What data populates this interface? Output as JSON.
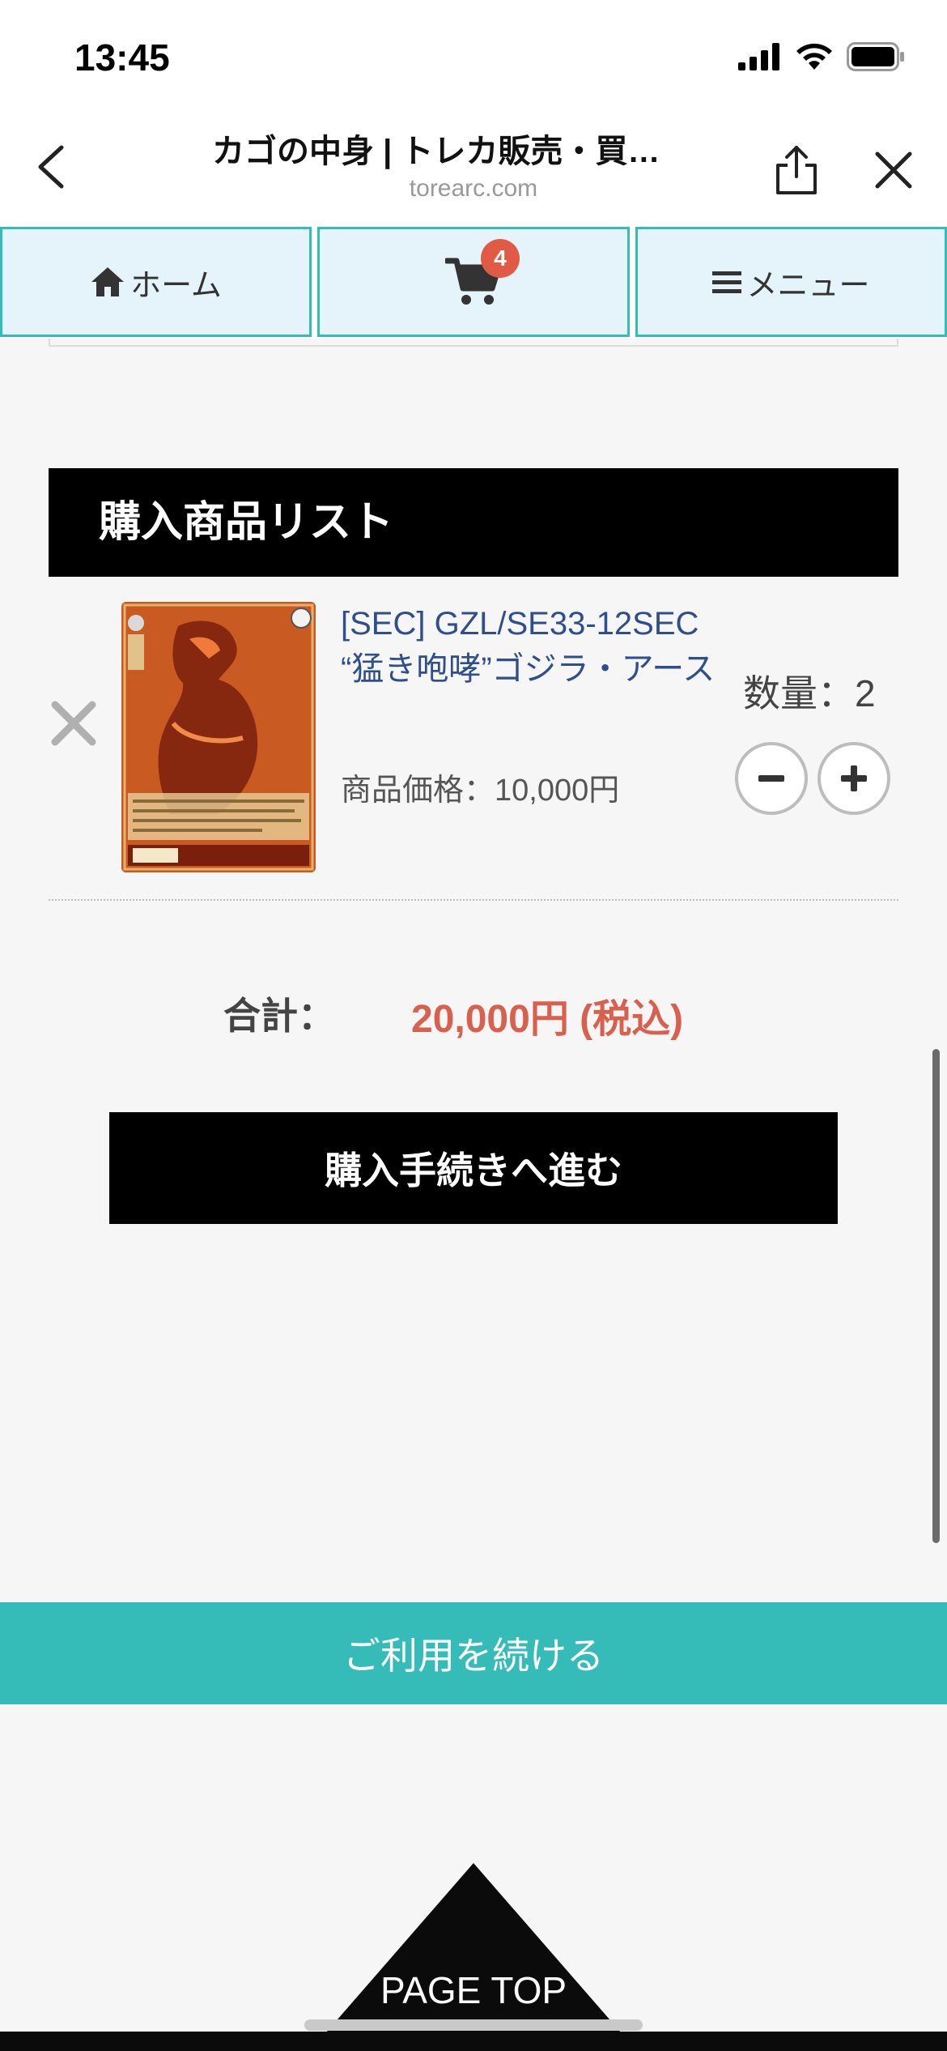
{
  "status_bar": {
    "time": "13:45"
  },
  "browser": {
    "title": "カゴの中身 | トレカ販売・買…",
    "domain": "torearc.com"
  },
  "nav": {
    "home_label": "ホーム",
    "cart_badge": "4",
    "menu_label": "メニュー"
  },
  "list": {
    "header": "購入商品リスト",
    "items": [
      {
        "name": "[SEC] GZL/SE33-12SEC “猛き咆哮”ゴジラ・アース",
        "price": "商品価格：10,000円",
        "quantity": "数量：2"
      }
    ]
  },
  "total": {
    "label": "合計：",
    "value": "20,000円 (税込)"
  },
  "checkout_label": "購入手続きへ進む",
  "continue_label": "ご利用を続ける",
  "page_top_label": "PAGE TOP",
  "colors": {
    "accent_teal": "#35bcb8",
    "nav_bg": "#e4f4fa",
    "price_red": "#d8614d",
    "badge_red": "#e05a45",
    "link_blue": "#2e4f8c"
  }
}
